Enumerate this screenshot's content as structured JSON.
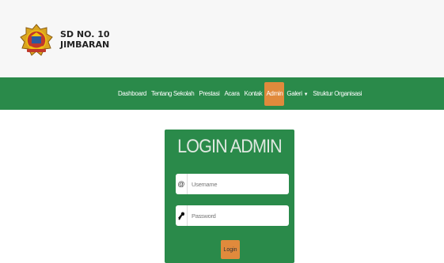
{
  "header": {
    "school_name_line1": "SD NO. 10",
    "school_name_line2": "JIMBARAN",
    "logo_icon": "school-crest-icon"
  },
  "nav": {
    "items": [
      {
        "label": "Dashboard"
      },
      {
        "label": "Tentang Sekolah"
      },
      {
        "label": "Prestasi"
      },
      {
        "label": "Acara"
      },
      {
        "label": "Kontak"
      },
      {
        "label": "Admin",
        "active": true
      },
      {
        "label": "Galeri",
        "dropdown": true
      },
      {
        "label": "Struktur Organisasi"
      }
    ]
  },
  "login": {
    "title": "LOGIN ADMIN",
    "username_placeholder": "Username",
    "username_icon": "at-sign-icon",
    "password_placeholder": "Password",
    "password_icon": "key-icon",
    "button_label": "Login"
  },
  "colors": {
    "primary_green": "#2a8a4a",
    "accent_orange": "#e08a3c",
    "header_bg": "#f7f7f7"
  }
}
